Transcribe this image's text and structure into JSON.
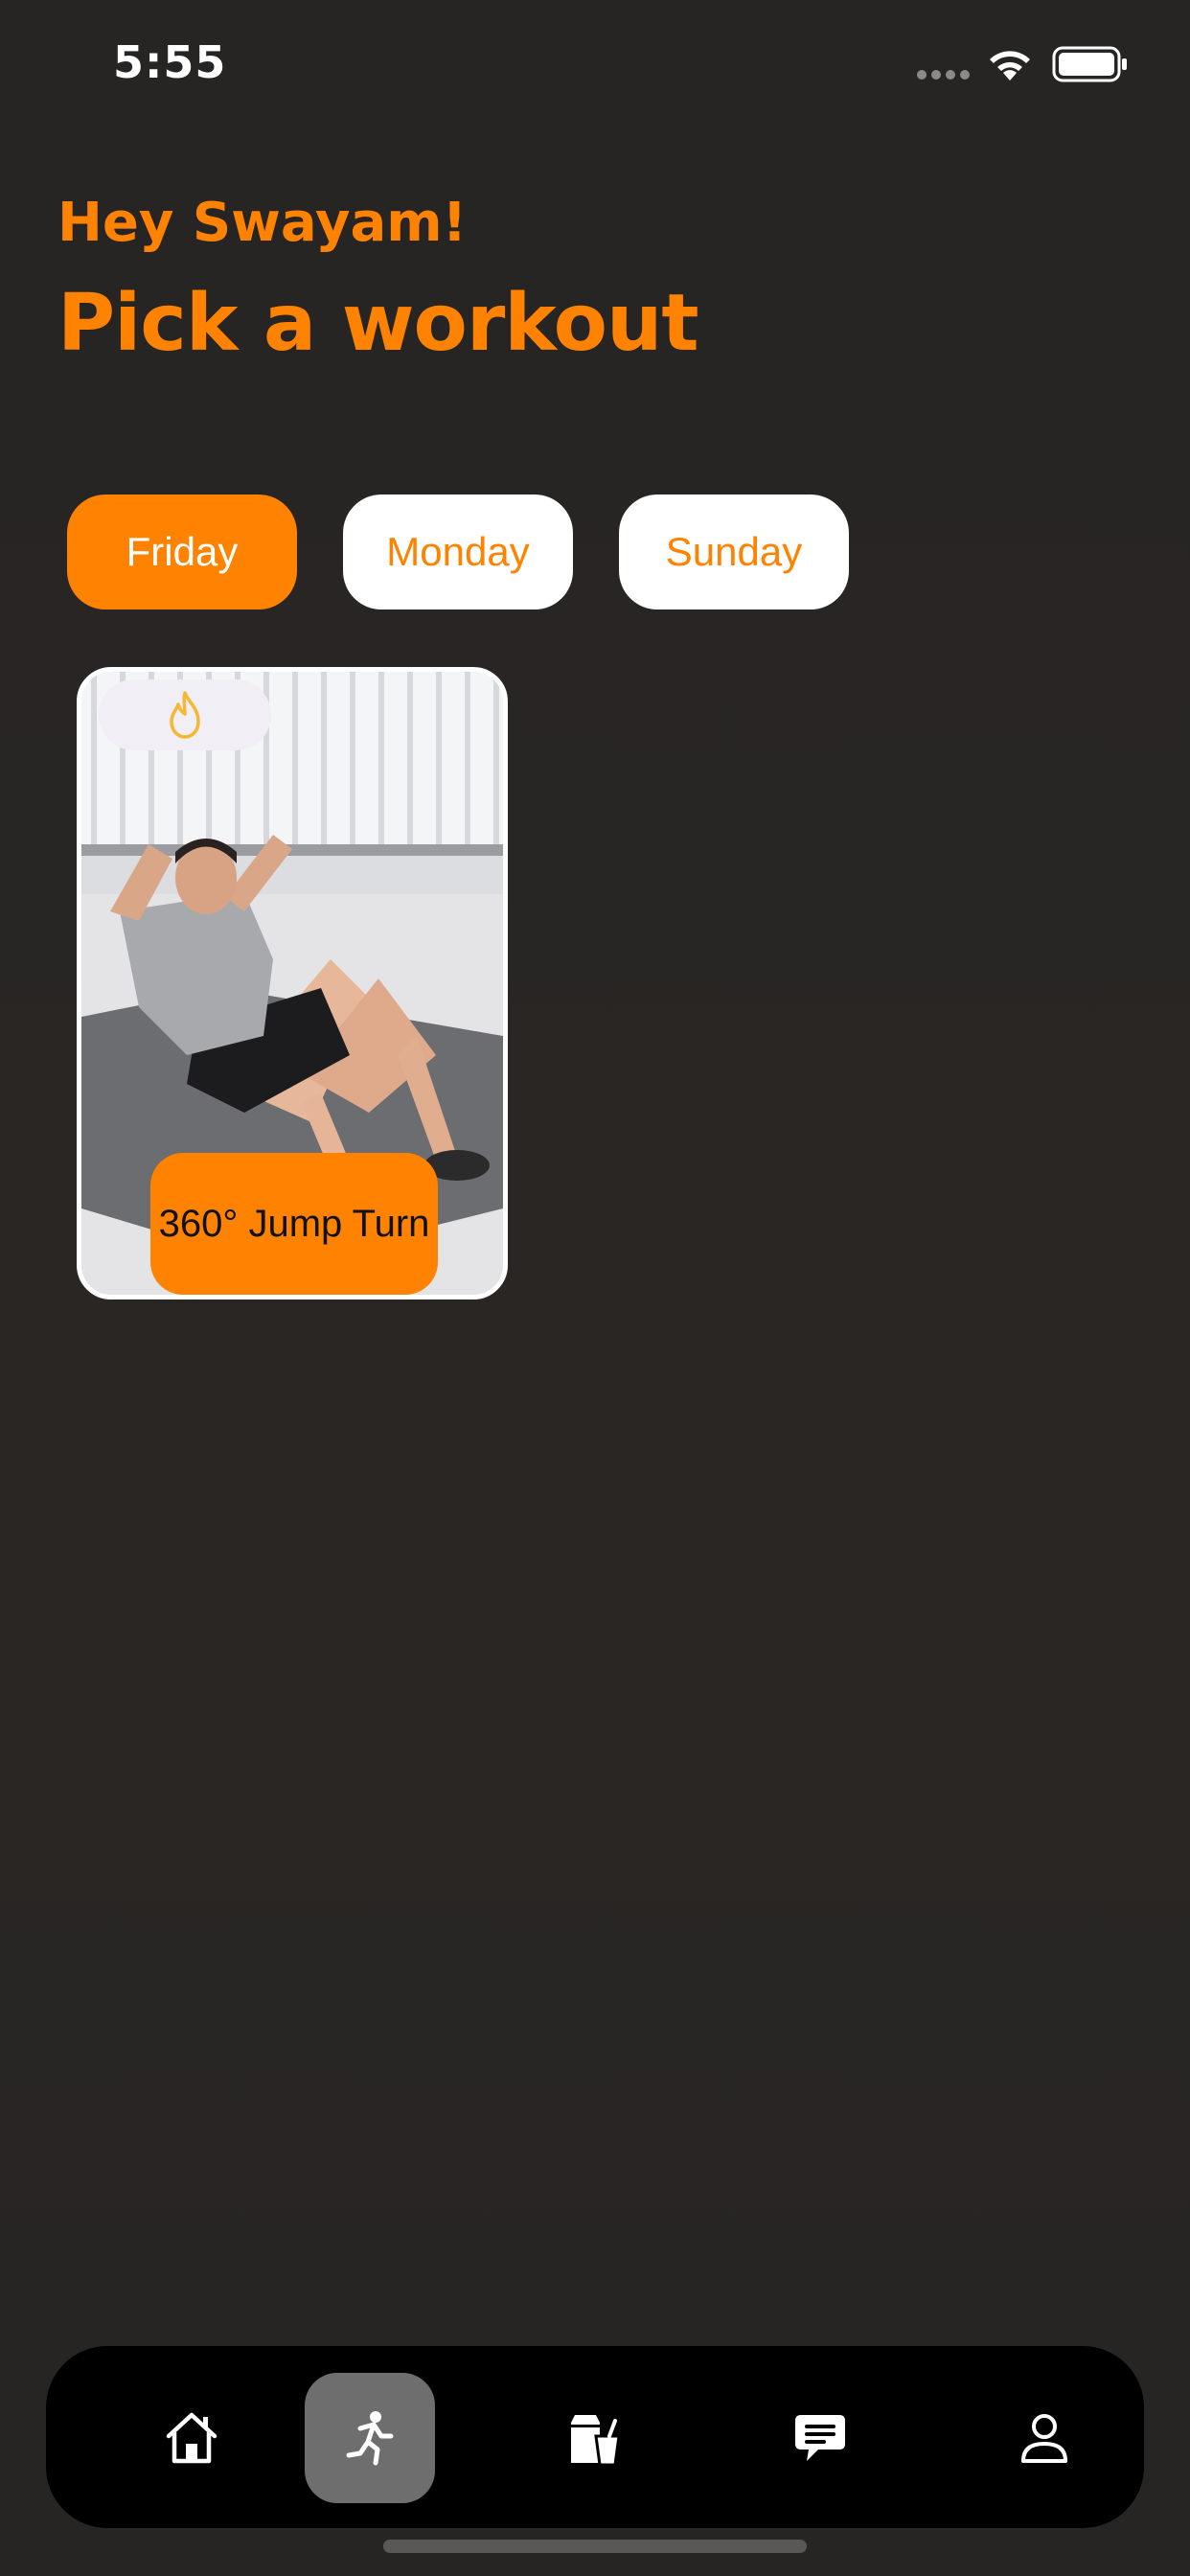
{
  "status_bar": {
    "time": "5:55",
    "icons": [
      "cellular-dots-icon",
      "wifi-icon",
      "battery-icon"
    ]
  },
  "header": {
    "greeting": "Hey Swayam!",
    "title": "Pick a workout"
  },
  "day_tabs": [
    {
      "label": "Friday",
      "selected": true
    },
    {
      "label": "Monday",
      "selected": false
    },
    {
      "label": "Sunday",
      "selected": false
    }
  ],
  "workouts": [
    {
      "name": "360° Jump Turn",
      "badge_icon": "flame-icon",
      "image": "man-doing-crunches-on-mat-photo"
    }
  ],
  "tab_bar": {
    "items": [
      {
        "icon": "home-icon",
        "selected": false
      },
      {
        "icon": "running-person-icon",
        "selected": true
      },
      {
        "icon": "meal-bag-cup-icon",
        "selected": false
      },
      {
        "icon": "chat-bubble-icon",
        "selected": false
      },
      {
        "icon": "profile-icon",
        "selected": false
      }
    ]
  },
  "colors": {
    "accent": "#ff8200",
    "background": "#282524",
    "tab_bar": "#000000",
    "tab_active": "#6e6e6e",
    "pill_inactive": "#ffffff"
  }
}
